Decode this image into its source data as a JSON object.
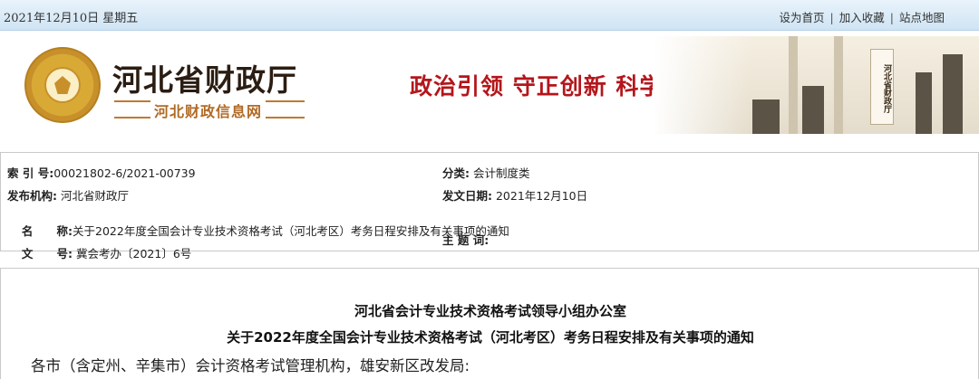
{
  "topbar": {
    "date": "2021年12月10日  星期五",
    "links": [
      "设为首页",
      "加入收藏",
      "站点地图"
    ],
    "separator": "|"
  },
  "banner": {
    "title": "河北省财政厅",
    "subtitle": "河北财政信息网",
    "slogan": "政治引领  守正创新  科学高效  竞进有为",
    "building_sign": "河北省财政厅"
  },
  "meta": {
    "index_label": "索 引 号:",
    "index_value": "00021802-6/2021-00739",
    "category_label": "分类:",
    "category_value": "会计制度类",
    "publisher_label": "发布机构:",
    "publisher_value": "河北省财政厅",
    "date_label": "发文日期:",
    "date_value": "2021年12月10日",
    "name_label": "名      称:",
    "name_value": "关于2022年度全国会计专业技术资格考试（河北考区）考务日程安排及有关事项的通知",
    "docno_label": "文      号:",
    "docno_value": "冀会考办〔2021〕6号",
    "subject_label": "主 题 词:",
    "subject_value": ""
  },
  "doc": {
    "title1": "河北省会计专业技术资格考试领导小组办公室",
    "title2": "关于2022年度全国会计专业技术资格考试（河北考区）考务日程安排及有关事项的通知",
    "salutation": "各市（含定州、辛集市）会计资格考试管理机构，雄安新区改发局:"
  },
  "colors": {
    "slogan": "#b4161b",
    "brand_sub": "#b06a24",
    "topbar_start": "#e9f3fb",
    "topbar_end": "#cfe4f4"
  }
}
